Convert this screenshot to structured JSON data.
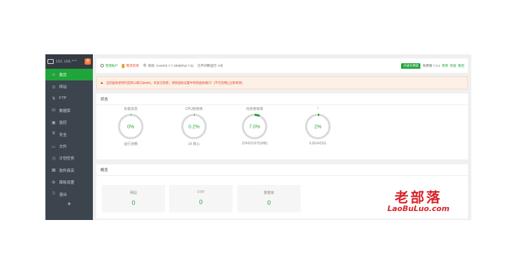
{
  "sidebar": {
    "host": "192.168.***",
    "badge": "8",
    "items": [
      {
        "label": "首页",
        "icon": "home-icon",
        "glyph": "⌂",
        "active": true
      },
      {
        "label": "网站",
        "icon": "globe-icon",
        "glyph": "◎"
      },
      {
        "label": "FTP",
        "icon": "ftp-icon",
        "glyph": "⇅"
      },
      {
        "label": "数据库",
        "icon": "database-icon",
        "glyph": "⛁"
      },
      {
        "label": "监控",
        "icon": "monitor-icon",
        "glyph": "▣"
      },
      {
        "label": "安全",
        "icon": "shield-icon",
        "glyph": "⛨"
      },
      {
        "label": "文件",
        "icon": "folder-icon",
        "glyph": "▭"
      },
      {
        "label": "计划任务",
        "icon": "clock-icon",
        "glyph": "◷"
      },
      {
        "label": "软件商店",
        "icon": "store-icon",
        "glyph": "▦"
      },
      {
        "label": "面板设置",
        "icon": "settings-icon",
        "glyph": "⚙"
      },
      {
        "label": "退出",
        "icon": "exit-icon",
        "glyph": "⎋"
      }
    ],
    "add": "+"
  },
  "topbar": {
    "account": "宝塔账户",
    "reward": "需求反馈",
    "system_label": "系统:",
    "system": "CentOS 7.7.1908(Py2.7.5)",
    "uptime": "已不间断运行: 6天",
    "upgrade": "升级付费版",
    "version_label": "免费版",
    "version": "7.3.1",
    "update": "更新",
    "repair": "修复",
    "restart": "重启"
  },
  "alert": {
    "text": "当前面板使用的是默认端口[8888]，有安全隐患，请到面板设置中修改面板端口！[不可忽略] [立即修改]"
  },
  "status": {
    "title": "状态",
    "gauges": [
      {
        "label": "负载状态",
        "value": "0%",
        "sub": "运行流畅",
        "fraction": 0.0,
        "color": "#20a53a"
      },
      {
        "label": "CPU使用率",
        "value": "0.2%",
        "sub": "24 核心",
        "fraction": 0.002,
        "color": "#20a53a"
      },
      {
        "label": "内存使用率",
        "value": "7.0%",
        "sub": "2249/31975(MB)",
        "fraction": 0.07,
        "color": "#20a53a"
      },
      {
        "label": "/",
        "value": "2%",
        "sub": "6.8G/423G",
        "fraction": 0.02,
        "color": "#20a53a"
      }
    ]
  },
  "overview": {
    "title": "概览",
    "cards": [
      {
        "label": "网站",
        "value": "0"
      },
      {
        "label": "FTP",
        "value": "0"
      },
      {
        "label": "数据库",
        "value": "0"
      }
    ]
  },
  "watermark": {
    "cn": "老部落",
    "en": "LaoBuLuo.com"
  }
}
